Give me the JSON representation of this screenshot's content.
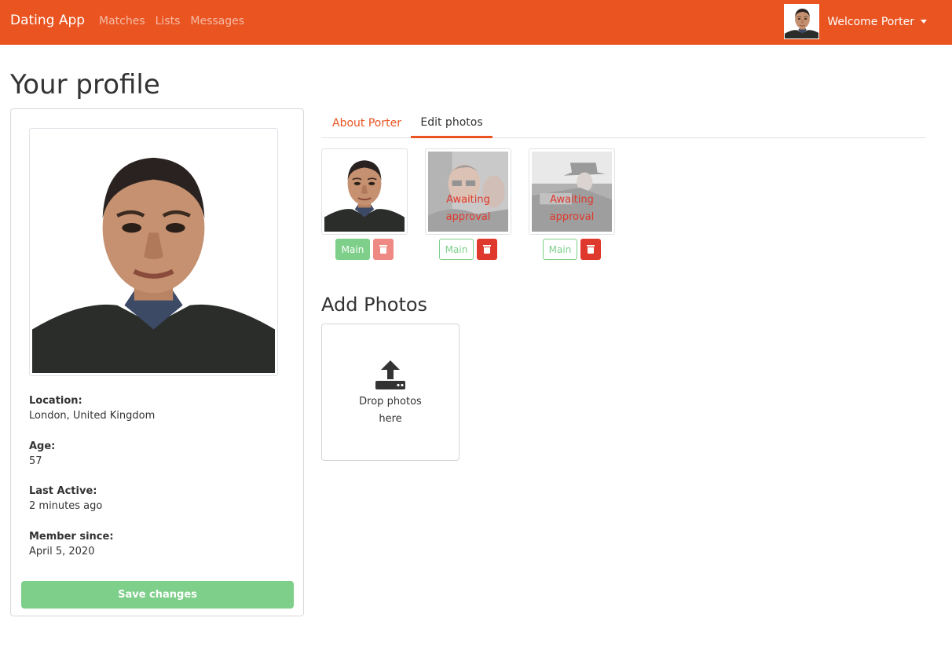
{
  "navbar": {
    "brand": "Dating App",
    "links": [
      "Matches",
      "Lists",
      "Messages"
    ],
    "welcome": "Welcome Porter",
    "color": "#e95420"
  },
  "page": {
    "title": "Your profile"
  },
  "profile": {
    "location_label": "Location:",
    "location": "London, United Kingdom",
    "age_label": "Age:",
    "age": "57",
    "last_active_label": "Last Active:",
    "last_active": "2 minutes ago",
    "member_since_label": "Member since:",
    "member_since": "April 5, 2020",
    "save_label": "Save changes"
  },
  "tabs": {
    "about": "About Porter",
    "edit_photos": "Edit photos"
  },
  "photos": [
    {
      "status": "approved",
      "main_label": "Main",
      "is_main": true
    },
    {
      "status": "Awaiting approval",
      "main_label": "Main",
      "is_main": false
    },
    {
      "status": "Awaiting approval",
      "main_label": "Main",
      "is_main": false
    }
  ],
  "awaiting_text": "Awaiting approval",
  "add_photos": {
    "title": "Add Photos",
    "drop_text": "Drop photos here"
  },
  "icons": {
    "upload": "upload-icon",
    "trash": "trash-icon",
    "caret": "chevron-down-icon"
  },
  "colors": {
    "primary": "#e95420",
    "success": "#7dcf8a",
    "danger": "#df382c"
  }
}
